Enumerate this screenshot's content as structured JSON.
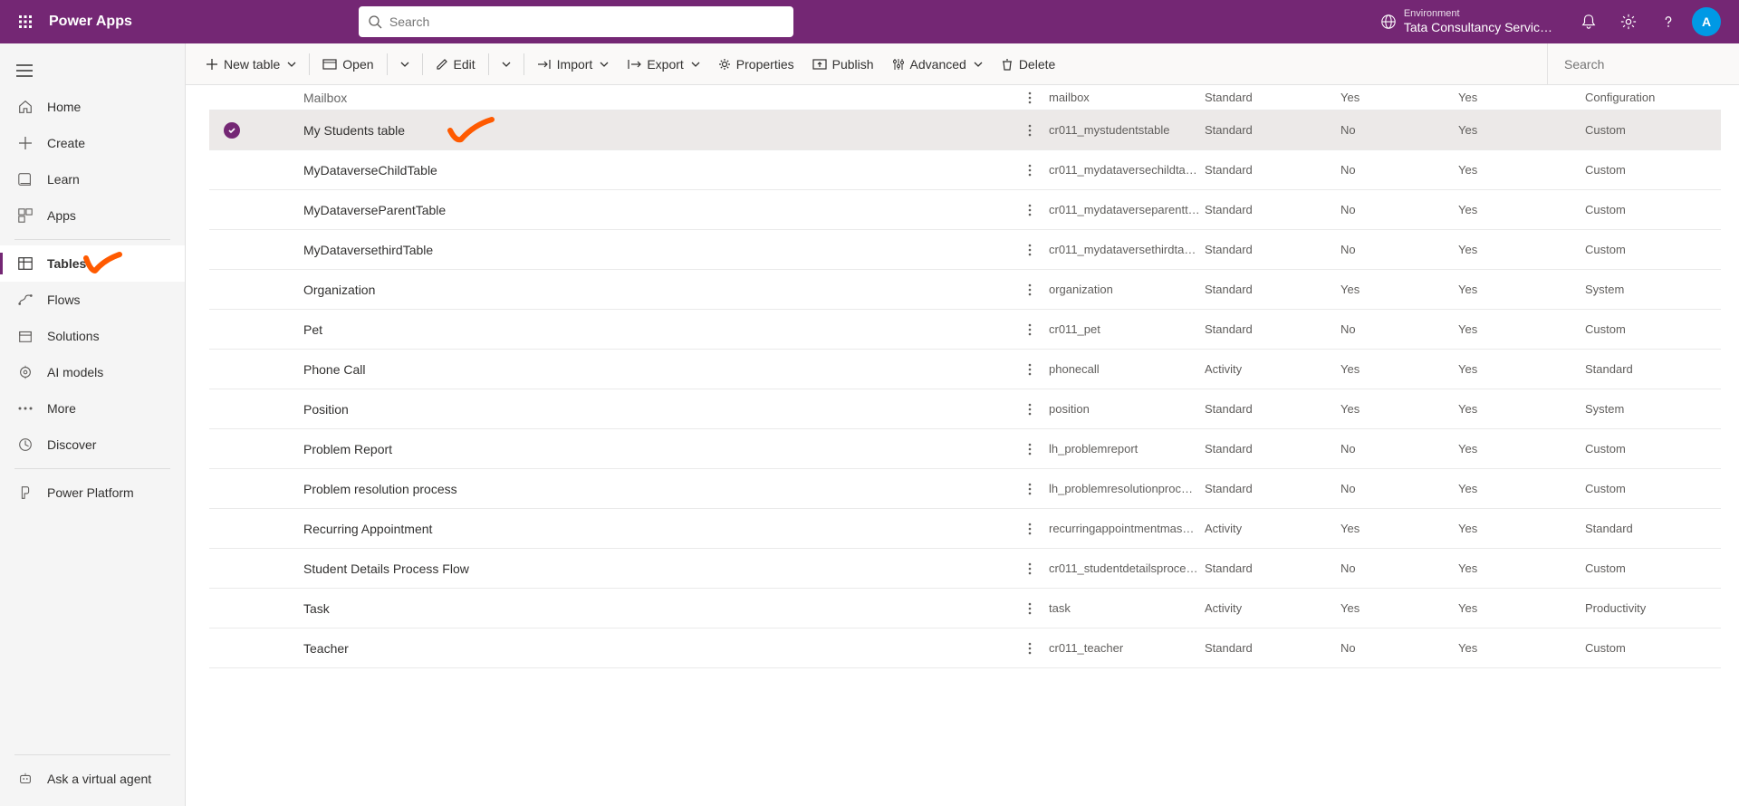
{
  "brand": "Power Apps",
  "search_placeholder": "Search",
  "environment": {
    "label": "Environment",
    "name": "Tata Consultancy Servic…"
  },
  "avatar_initial": "A",
  "leftnav": {
    "home": "Home",
    "create": "Create",
    "learn": "Learn",
    "apps": "Apps",
    "tables": "Tables",
    "flows": "Flows",
    "solutions": "Solutions",
    "ai_models": "AI models",
    "more": "More",
    "discover": "Discover",
    "power_platform": "Power Platform",
    "ask_agent": "Ask a virtual agent"
  },
  "cmdbar": {
    "new_table": "New table",
    "open": "Open",
    "edit": "Edit",
    "import_": "Import",
    "export_": "Export",
    "properties": "Properties",
    "publish": "Publish",
    "advanced": "Advanced",
    "delete_": "Delete",
    "search_placeholder": "Search"
  },
  "rows": [
    {
      "name": "Mailbox",
      "schema": "mailbox",
      "type": "Standard",
      "managed": "Yes",
      "cust": "Yes",
      "tags": "Configuration",
      "partial": true
    },
    {
      "name": "My Students table",
      "schema": "cr011_mystudentstable",
      "type": "Standard",
      "managed": "No",
      "cust": "Yes",
      "tags": "Custom",
      "selected": true
    },
    {
      "name": "MyDataverseChildTable",
      "schema": "cr011_mydataversechildta…",
      "type": "Standard",
      "managed": "No",
      "cust": "Yes",
      "tags": "Custom"
    },
    {
      "name": "MyDataverseParentTable",
      "schema": "cr011_mydataverseparentt…",
      "type": "Standard",
      "managed": "No",
      "cust": "Yes",
      "tags": "Custom"
    },
    {
      "name": "MyDataversethirdTable",
      "schema": "cr011_mydataversethirdta…",
      "type": "Standard",
      "managed": "No",
      "cust": "Yes",
      "tags": "Custom"
    },
    {
      "name": "Organization",
      "schema": "organization",
      "type": "Standard",
      "managed": "Yes",
      "cust": "Yes",
      "tags": "System"
    },
    {
      "name": "Pet",
      "schema": "cr011_pet",
      "type": "Standard",
      "managed": "No",
      "cust": "Yes",
      "tags": "Custom"
    },
    {
      "name": "Phone Call",
      "schema": "phonecall",
      "type": "Activity",
      "managed": "Yes",
      "cust": "Yes",
      "tags": "Standard"
    },
    {
      "name": "Position",
      "schema": "position",
      "type": "Standard",
      "managed": "Yes",
      "cust": "Yes",
      "tags": "System"
    },
    {
      "name": "Problem Report",
      "schema": "lh_problemreport",
      "type": "Standard",
      "managed": "No",
      "cust": "Yes",
      "tags": "Custom"
    },
    {
      "name": "Problem resolution process",
      "schema": "lh_problemresolutionproc…",
      "type": "Standard",
      "managed": "No",
      "cust": "Yes",
      "tags": "Custom"
    },
    {
      "name": "Recurring Appointment",
      "schema": "recurringappointmentmas…",
      "type": "Activity",
      "managed": "Yes",
      "cust": "Yes",
      "tags": "Standard"
    },
    {
      "name": "Student Details Process Flow",
      "schema": "cr011_studentdetailsproce…",
      "type": "Standard",
      "managed": "No",
      "cust": "Yes",
      "tags": "Custom"
    },
    {
      "name": "Task",
      "schema": "task",
      "type": "Activity",
      "managed": "Yes",
      "cust": "Yes",
      "tags": "Productivity"
    },
    {
      "name": "Teacher",
      "schema": "cr011_teacher",
      "type": "Standard",
      "managed": "No",
      "cust": "Yes",
      "tags": "Custom"
    }
  ]
}
